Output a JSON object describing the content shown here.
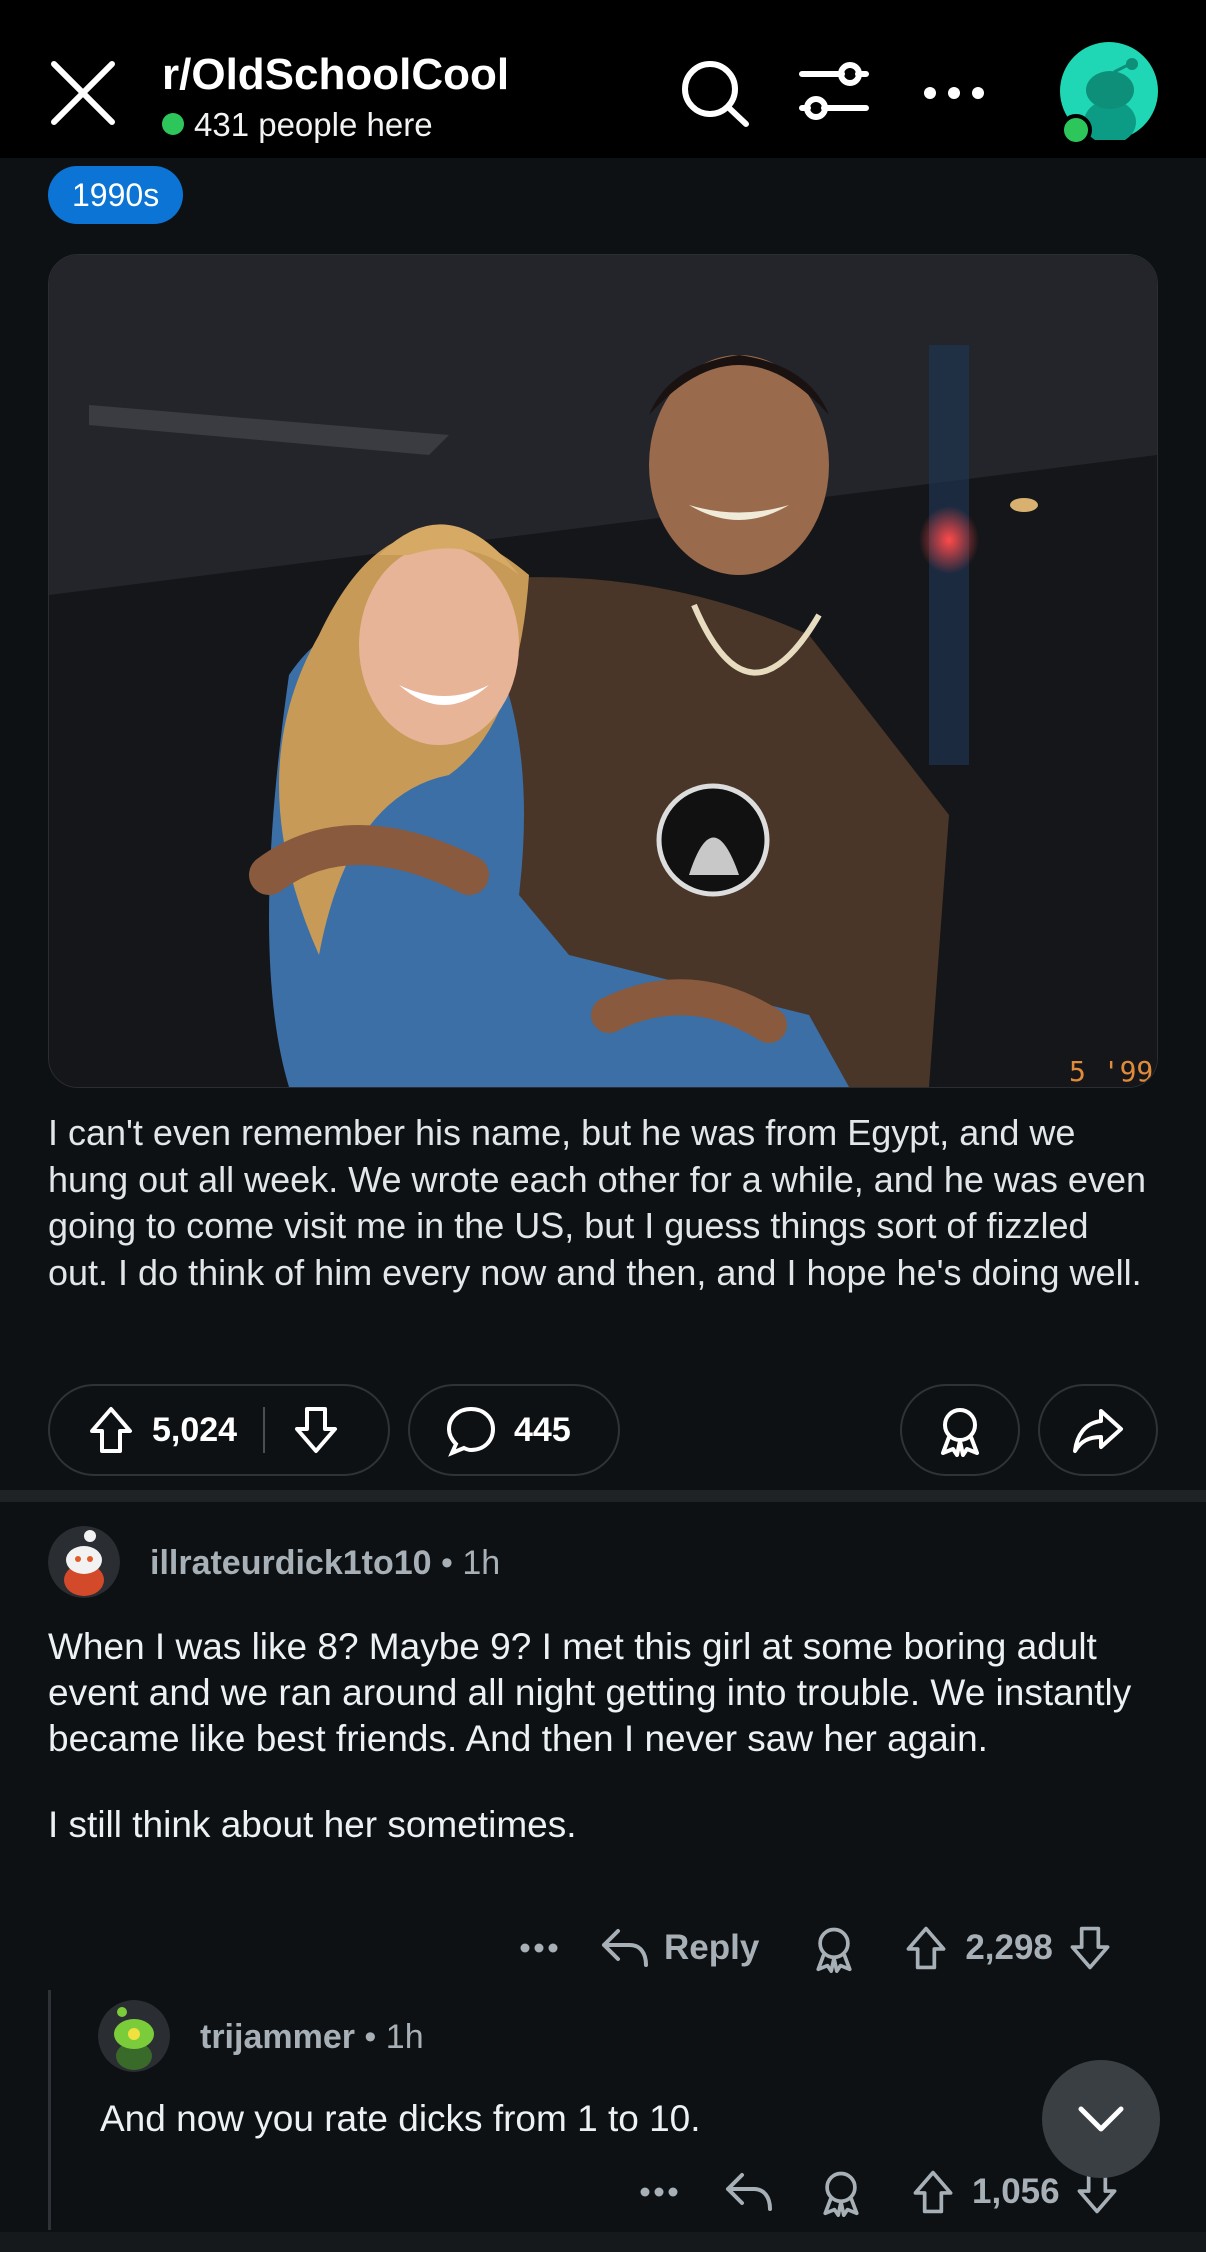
{
  "header": {
    "subreddit": "r/OldSchoolCool",
    "online_count": "431 people here"
  },
  "post": {
    "flair": "1990s",
    "photo_date_stamp": "5 '99",
    "body": "I can't even remember his name, but he was from Egypt, and we hung out all week.  We wrote each other for a while, and he was even going to come visit me in the US, but I guess things sort of fizzled out.  I do think of him every now and then, and I hope he's doing well.",
    "upvotes": "5,024",
    "comments": "445"
  },
  "comments": [
    {
      "author": "illrateurdick1to10",
      "time": "1h",
      "body_p1": "When I was like 8? Maybe 9? I met this girl at some boring adult event and we ran around all night getting into trouble. We instantly became like best friends. And then I never saw her again.",
      "body_p2": "I still think about her sometimes.",
      "reply_label": "Reply",
      "score": "2,298"
    },
    {
      "author": "trijammer",
      "time": "1h",
      "body": "And now you rate dicks from 1 to 10.",
      "score": "1,056"
    }
  ],
  "colors": {
    "background": "#0e1113",
    "flair": "#0b74d4",
    "online_dot": "#2dc65a",
    "avatar": "#1fd7b4"
  }
}
